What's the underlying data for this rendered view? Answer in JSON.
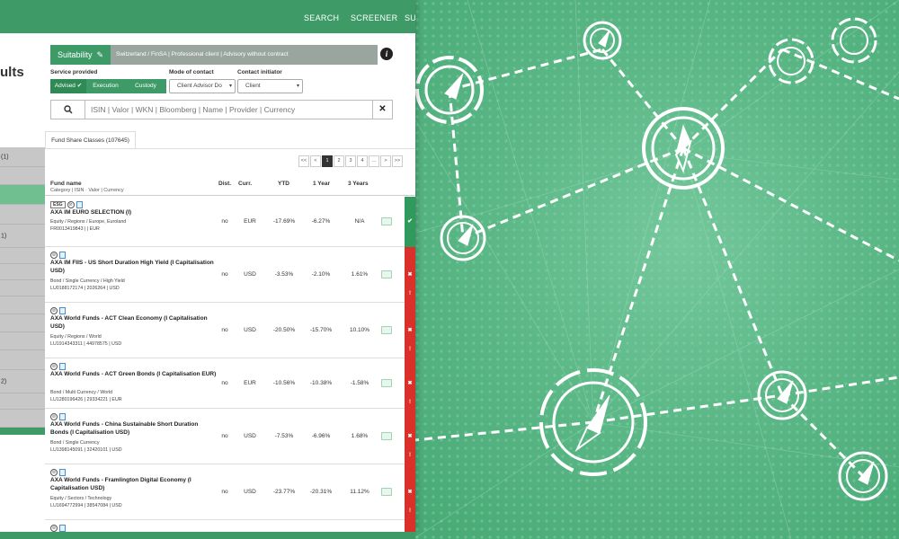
{
  "nav": {
    "search": "SEARCH",
    "screener": "SCREENER",
    "partial": "SU"
  },
  "side": {
    "title_partial": "ults",
    "counts": [
      "(1)",
      "1)",
      "2)"
    ]
  },
  "suitability": {
    "label": "Suitability",
    "summary": "Switzerland / FinSA | Professional client | Advisory without contract",
    "info_icon": "i"
  },
  "filters": {
    "service_label": "Service provided",
    "services": [
      {
        "label": "Advised ✔",
        "active": true
      },
      {
        "label": "Execution",
        "active": false
      },
      {
        "label": "Custody",
        "active": false
      }
    ],
    "mode_label": "Mode of contact",
    "mode_value": "Client Advisor Do",
    "initiator_label": "Contact initiator",
    "initiator_value": "Client"
  },
  "search": {
    "placeholder": "ISIN | Valor | WKN | Bloomberg | Name | Provider | Currency"
  },
  "results": {
    "tab_label": "Fund Share Classes (107645)",
    "pager": [
      "<<",
      "<",
      "1",
      "2",
      "3",
      "4",
      "...",
      ">",
      ">>"
    ],
    "current_page": "1",
    "headers": {
      "fund_name": "Fund name",
      "fund_sub": "Category | ISIN · Valor | Currency",
      "dist": "Dist.",
      "curr": "Curr.",
      "ytd": "YTD",
      "y1": "1 Year",
      "y3": "3 Years"
    },
    "rows": [
      {
        "esg": "ESG",
        "name": "AXA IM EURO SELECTION (I)",
        "category": "Equity / Regions / Europe, Euroland",
        "ids": "FR0013419843 |  | EUR",
        "dist": "no",
        "curr": "EUR",
        "ytd": "-17.69%",
        "y1": "-6.27%",
        "y3": "N/A",
        "status": "ok"
      },
      {
        "esg": "",
        "name": "AXA IM FIIS - US Short Duration High Yield (I Capitalisation USD)",
        "category": "Bond / Single Currency / High Yield",
        "ids": "LU0188172174 | 2026264 | USD",
        "dist": "no",
        "curr": "USD",
        "ytd": "-3.53%",
        "y1": "-2.10%",
        "y3": "1.61%",
        "status": "fail"
      },
      {
        "esg": "",
        "name": "AXA World Funds - ACT Clean Economy (I Capitalisation USD)",
        "category": "Equity / Regions / World",
        "ids": "LU1914343311 | 44978575 | USD",
        "dist": "no",
        "curr": "USD",
        "ytd": "-20.50%",
        "y1": "-15.70%",
        "y3": "10.10%",
        "status": "fail"
      },
      {
        "esg": "",
        "name": "AXA World Funds - ACT Green Bonds (I Capitalisation EUR)",
        "category": "Bond / Multi Currency / World",
        "ids": "LU1280196426 | 29334221 | EUR",
        "dist": "no",
        "curr": "EUR",
        "ytd": "-10.56%",
        "y1": "-10.38%",
        "y3": "-1.58%",
        "status": "fail"
      },
      {
        "esg": "",
        "name": "AXA World Funds - China Sustainable Short Duration Bonds (I Capitalisation USD)",
        "category": "Bond / Single Currency",
        "ids": "LU1398145091 | 32420101 | USD",
        "dist": "no",
        "curr": "USD",
        "ytd": "-7.53%",
        "y1": "-6.96%",
        "y3": "1.68%",
        "status": "fail"
      },
      {
        "esg": "",
        "name": "AXA World Funds - Framlington Digital Economy (I Capitalisation USD)",
        "category": "Equity / Sectors / Technology",
        "ids": "LU1694772994 | 38547084 | USD",
        "dist": "no",
        "curr": "USD",
        "ytd": "-23.77%",
        "y1": "-20.31%",
        "y3": "11.12%",
        "status": "fail"
      }
    ]
  },
  "colors": {
    "brand": "#3e9b67",
    "ok": "#2f9a5c",
    "fail": "#d9302a",
    "background": "#5cb887"
  }
}
